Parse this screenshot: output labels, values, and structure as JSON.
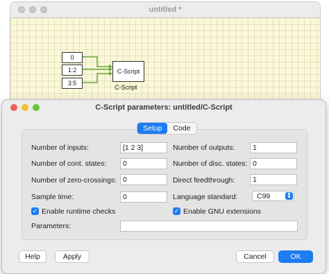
{
  "main_window": {
    "title": "untitled *"
  },
  "diagram": {
    "const_blocks": [
      "0",
      "1:2",
      "3:5"
    ],
    "cscript_block": {
      "label": "C-Script",
      "caption": "C-Script"
    }
  },
  "dialog": {
    "title": "C-Script parameters: untitled/C-Script",
    "tabs": [
      {
        "label": "Setup",
        "active": true
      },
      {
        "label": "Code",
        "active": false
      }
    ],
    "fields": {
      "num_inputs": {
        "label": "Number of inputs:",
        "value": "[1 2 3]"
      },
      "num_outputs": {
        "label": "Number of outputs:",
        "value": "1"
      },
      "cont_states": {
        "label": "Number of cont. states:",
        "value": "0"
      },
      "disc_states": {
        "label": "Number of disc. states:",
        "value": "0"
      },
      "zero_crossings": {
        "label": "Number of zero-crossings:",
        "value": "0"
      },
      "direct_feedthrough": {
        "label": "Direct feedthrough:",
        "value": "1"
      },
      "sample_time": {
        "label": "Sample time:",
        "value": "0"
      },
      "language_standard": {
        "label": "Language standard:",
        "value": "C99"
      },
      "parameters": {
        "label": "Parameters:",
        "value": ""
      }
    },
    "checkboxes": {
      "runtime_checks": {
        "label": "Enable runtime checks",
        "checked": true
      },
      "gnu_extensions": {
        "label": "Enable GNU extensions",
        "checked": true
      }
    },
    "buttons": {
      "help": "Help",
      "apply": "Apply",
      "cancel": "Cancel",
      "ok": "OK"
    }
  }
}
